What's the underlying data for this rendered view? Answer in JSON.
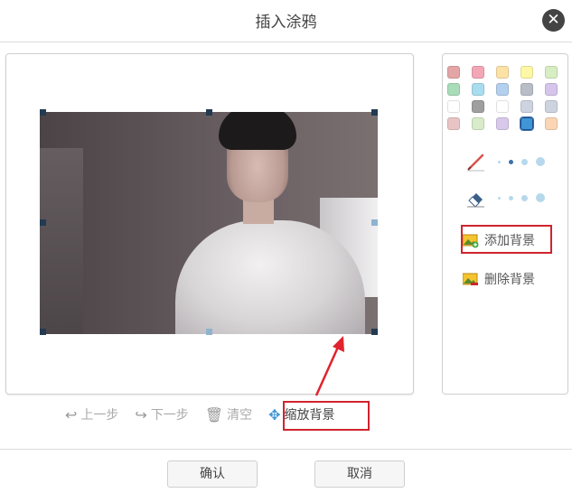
{
  "dialog": {
    "title": "插入涂鸦",
    "close_icon": "close-icon"
  },
  "palette": {
    "colors": [
      "#e3a5a5",
      "#f3a6b6",
      "#fde2a6",
      "#fef8a6",
      "#d6eec2",
      "#a9dcb8",
      "#a9dcef",
      "#b3d0ee",
      "#b8bdc8",
      "#d5c5ec",
      "#ffffff",
      "#9f9f9f",
      "#ffffff",
      "#cdd3df",
      "#cdd3df",
      "#e9c4c4",
      "#d8ecc9",
      "#d8c9ec",
      "#3f95d6",
      "#fad6b4"
    ],
    "selected_index": 18
  },
  "tools": {
    "brush_icon": "brush-icon",
    "eraser_icon": "eraser-icon"
  },
  "background": {
    "add_label": "添加背景",
    "remove_label": "删除背景"
  },
  "toolbar": {
    "undo_label": "上一步",
    "redo_label": "下一步",
    "clear_label": "清空",
    "scale_bg_label": "缩放背景"
  },
  "footer": {
    "confirm_label": "确认",
    "cancel_label": "取消"
  }
}
